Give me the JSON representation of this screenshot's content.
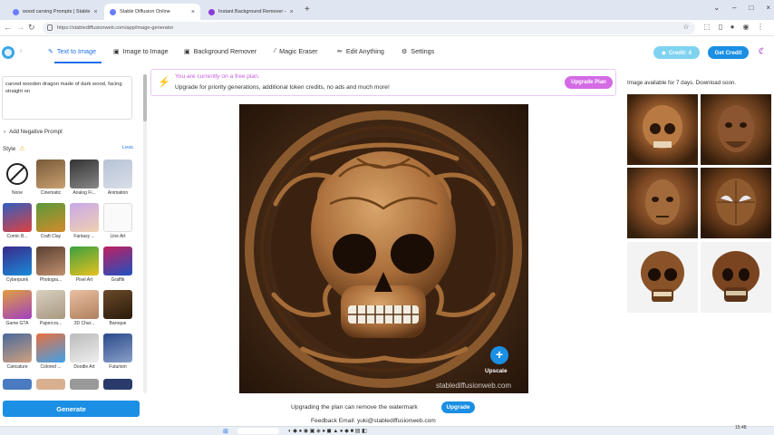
{
  "browser": {
    "tabs": [
      {
        "title": "wood carving Prompts | Stable",
        "active": false
      },
      {
        "title": "Stable Diffusion Online",
        "active": true
      },
      {
        "title": "Instant Background Remover - ",
        "active": false
      }
    ],
    "new_tab": "+",
    "url": "https://stablediffusionweb.com/app/image-generator"
  },
  "nav": {
    "items": [
      {
        "label": "Text to Image",
        "icon": "pen-sparkle-icon",
        "active": true
      },
      {
        "label": "Image to Image",
        "icon": "image-icon",
        "active": false
      },
      {
        "label": "Background Remover",
        "icon": "image-icon",
        "active": false
      },
      {
        "label": "Magic Eraser",
        "icon": "wand-icon",
        "active": false
      },
      {
        "label": "Edit Anything",
        "icon": "pencil-icon",
        "active": false
      },
      {
        "label": "Settings",
        "icon": "gear-icon",
        "active": false
      }
    ],
    "credit_label": "Credit: 4",
    "get_credit_label": "Get Credit"
  },
  "left": {
    "prompt_text": "carved wooden dragon made of dark wood, facing straight on",
    "negative_prompt_label": "Add Negative Prompt",
    "style_label": "Style",
    "less_label": "Less",
    "styles": [
      {
        "name": "None"
      },
      {
        "name": "Cinematic"
      },
      {
        "name": "Analog Fi..."
      },
      {
        "name": "Animation"
      },
      {
        "name": "Comic B..."
      },
      {
        "name": "Craft Clay"
      },
      {
        "name": "Fantasy ..."
      },
      {
        "name": "Line Art"
      },
      {
        "name": "Cyberpunk"
      },
      {
        "name": "Photogra..."
      },
      {
        "name": "Pixel Art"
      },
      {
        "name": "Graffiti"
      },
      {
        "name": "Game GTA"
      },
      {
        "name": "Papercra..."
      },
      {
        "name": "3D Char..."
      },
      {
        "name": "Baroque"
      },
      {
        "name": "Caricature"
      },
      {
        "name": "Colored ..."
      },
      {
        "name": "Doodle Art"
      },
      {
        "name": "Futurism"
      }
    ],
    "generate_label": "Generate"
  },
  "banner": {
    "line1": "You are currently on a free plan.",
    "line2": "Upgrade for priority generations, additional token credits, no ads and much more!",
    "button": "Upgrade Plan"
  },
  "main": {
    "watermark": "stablediffusionweb.com",
    "upscale_label": "Upscale",
    "upgrade_note": "Upgrading the plan can remove the watermark",
    "upgrade_button": "Upgrade",
    "feedback": "Feedback Email: yuki@stablediffusionweb.com"
  },
  "gallery": {
    "note": "Image available for 7 days. Download soon."
  },
  "taskbar": {
    "time": "15:48"
  },
  "colors": {
    "accent": "#1f6feb",
    "generate": "#1a8fe3",
    "credit_bg": "#7fd3f0",
    "get_credit_bg": "#1a8fe3",
    "upgrade_plan_bg": "#d46be5",
    "wood_dark": "#3a2412",
    "wood_light": "#b07a45"
  }
}
